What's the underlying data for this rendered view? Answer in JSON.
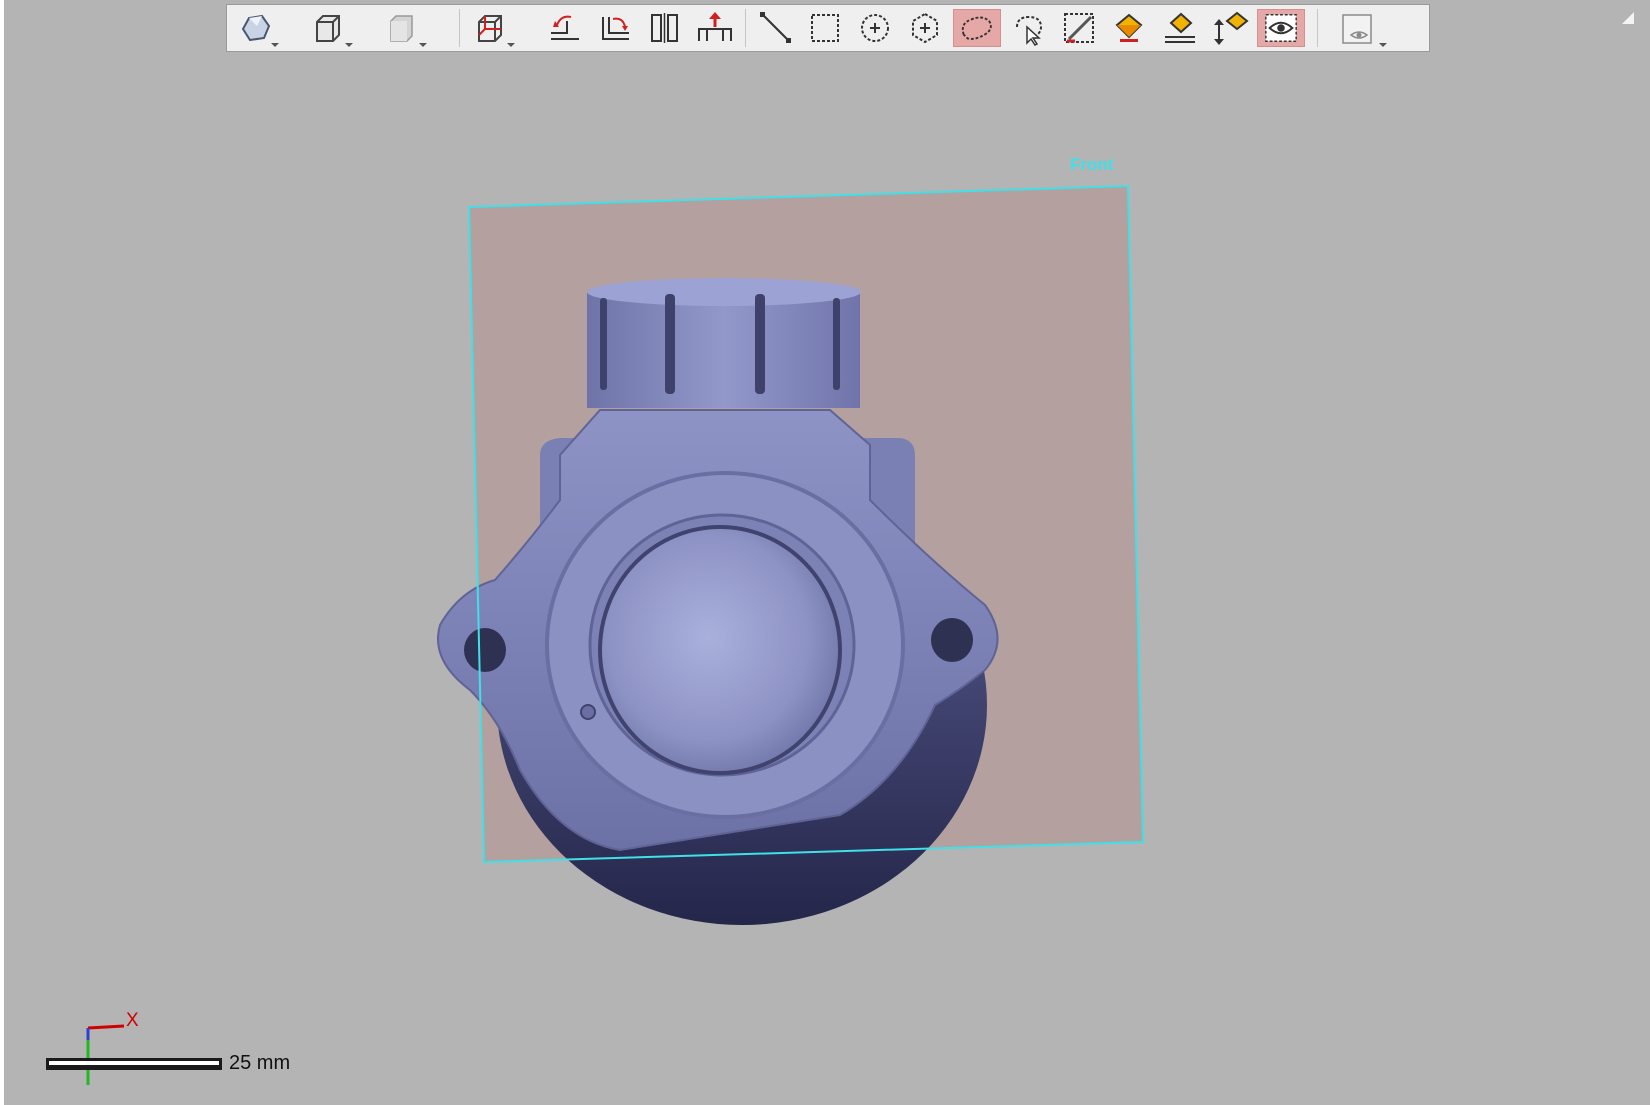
{
  "viewport": {
    "plane_label": "Front",
    "axis_x_label": "X",
    "scale_text": "25 mm"
  },
  "toolbar": {
    "items": [
      {
        "name": "view-shaded-icon",
        "has_dropdown": true
      },
      {
        "name": "view-cube-icon",
        "has_dropdown": true
      },
      {
        "name": "view-solid-icon",
        "has_dropdown": true
      },
      {
        "name": "view-wireframe-box-icon",
        "has_dropdown": true
      },
      {
        "name": "rotate-plane-icon"
      },
      {
        "name": "flip-plane-icon"
      },
      {
        "name": "split-plane-icon"
      },
      {
        "name": "extrude-plane-icon"
      },
      {
        "name": "line-select-icon"
      },
      {
        "name": "rectangle-select-icon"
      },
      {
        "name": "circle-select-icon"
      },
      {
        "name": "polygon-select-icon"
      },
      {
        "name": "lasso-select-icon",
        "active": true
      },
      {
        "name": "paint-select-icon"
      },
      {
        "name": "brush-select-icon"
      },
      {
        "name": "fill-color-icon"
      },
      {
        "name": "fill-plane-icon"
      },
      {
        "name": "fill-adjust-icon"
      },
      {
        "name": "visibility-eye-icon",
        "active": true
      },
      {
        "name": "display-options-icon",
        "has_dropdown": true
      }
    ]
  },
  "colors": {
    "background": "#b4b4b4",
    "plane_outline": "#3fe0e8",
    "plane_fill": "#b4a09e",
    "part_color": "#7a7fb3",
    "active_button": "#e6a7a7",
    "axis_x": "#d10000",
    "axis_y": "#1fb81f"
  }
}
